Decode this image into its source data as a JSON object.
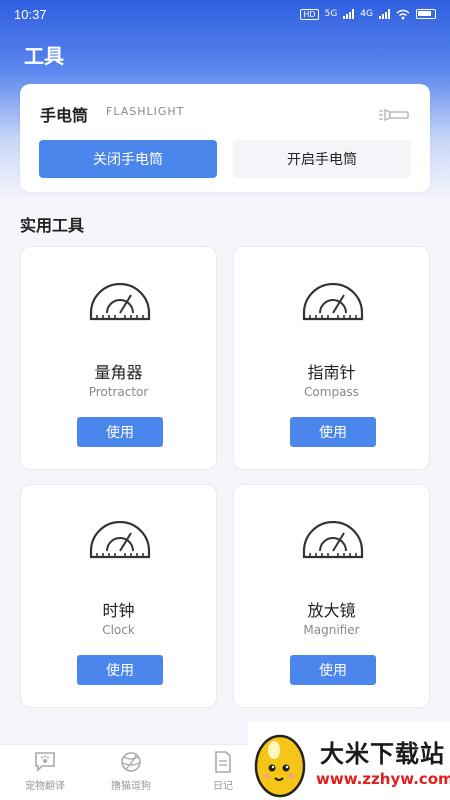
{
  "status_bar": {
    "time": "10:37",
    "network": "5G",
    "network2": "4G"
  },
  "page": {
    "title": "工具"
  },
  "flashlight": {
    "title": "手电筒",
    "subtitle": "FLASHLIGHT",
    "off_label": "关闭手电筒",
    "on_label": "开启手电筒"
  },
  "section": {
    "title": "实用工具"
  },
  "tools": [
    {
      "name": "量角器",
      "en": "Protractor",
      "button": "使用",
      "icon": "protractor-icon"
    },
    {
      "name": "指南针",
      "en": "Compass",
      "button": "使用",
      "icon": "protractor-icon"
    },
    {
      "name": "时钟",
      "en": "Clock",
      "button": "使用",
      "icon": "protractor-icon"
    },
    {
      "name": "放大镜",
      "en": "Magnifier",
      "button": "使用",
      "icon": "protractor-icon"
    }
  ],
  "tab_bar": {
    "items": [
      {
        "label": "宠物翻译",
        "icon": "chat-paw-icon"
      },
      {
        "label": "撸猫逗狗",
        "icon": "yarn-ball-icon"
      },
      {
        "label": "日记",
        "icon": "document-icon"
      }
    ]
  },
  "watermark": {
    "title": "大米下载站",
    "url": "www.zzhyw.com"
  },
  "colors": {
    "accent": "#4b86ec",
    "header": "#2f5fe0"
  }
}
